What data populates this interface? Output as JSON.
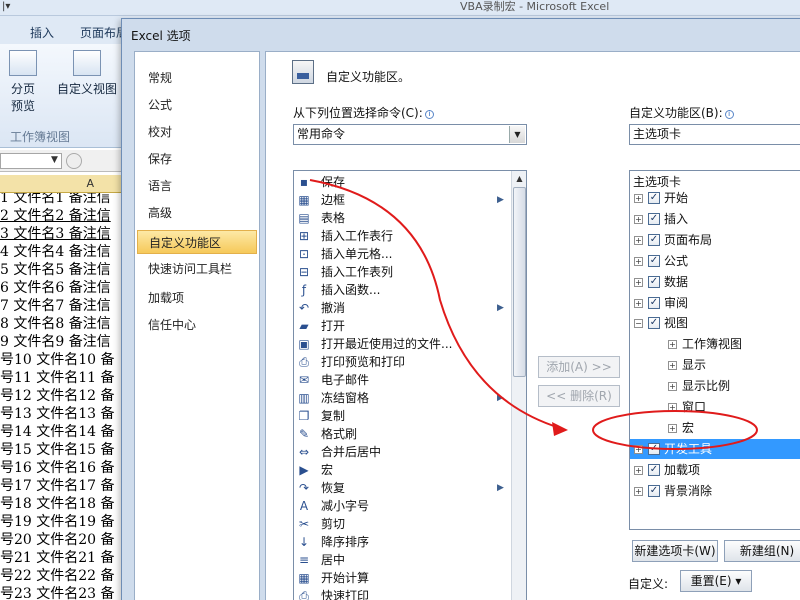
{
  "app": {
    "window_title": "VBA录制宏 - Microsoft Excel",
    "ribbon_tabs": [
      "插入",
      "页面布局"
    ],
    "ribbon_buttons": [
      {
        "name": "page-preview",
        "label_line1": "分页",
        "label_line2": "预览"
      },
      {
        "name": "custom-view",
        "label": "自定义视图"
      }
    ],
    "group_label": "工作簿视图",
    "column_header": "A",
    "rows": [
      "1  文件名1  备注信",
      "2  文件名2  备注信",
      "3  文件名3  备注信",
      "4  文件名4  备注信",
      "5  文件名5  备注信",
      "6  文件名6  备注信",
      "7  文件名7  备注信",
      "8  文件名8  备注信",
      "9  文件名9  备注信",
      "号10  文件名10  备",
      "号11  文件名11  备",
      "号12  文件名12  备",
      "号13  文件名13  备",
      "号14  文件名14  备",
      "号15  文件名15  备",
      "号16  文件名16  备",
      "号17  文件名17  备",
      "号18  文件名18  备",
      "号19  文件名19  备",
      "号20  文件名20  备",
      "号21  文件名21  备",
      "号22  文件名22  备",
      "号23  文件名23  备"
    ]
  },
  "dialog": {
    "title": "Excel 选项",
    "nav": [
      "常规",
      "公式",
      "校对",
      "保存",
      "语言",
      "高级",
      "自定义功能区",
      "快速访问工具栏",
      "加载项",
      "信任中心"
    ],
    "nav_selected": "自定义功能区",
    "header": "自定义功能区。",
    "choose_from_label": "从下列位置选择命令(C):",
    "choose_from_value": "常用命令",
    "customize_label": "自定义功能区(B):",
    "customize_value": "主选项卡",
    "commands": [
      {
        "icon": "save-icon",
        "glyph": "▪",
        "label": "保存",
        "submenu": false
      },
      {
        "icon": "border-icon",
        "glyph": "▦",
        "label": "边框",
        "submenu": true
      },
      {
        "icon": "table-icon",
        "glyph": "▤",
        "label": "表格",
        "submenu": false
      },
      {
        "icon": "insert-sheet-row-icon",
        "glyph": "⊞",
        "label": "插入工作表行",
        "submenu": false
      },
      {
        "icon": "insert-cell-icon",
        "glyph": "⊡",
        "label": "插入单元格...",
        "submenu": false
      },
      {
        "icon": "insert-sheet-column-icon",
        "glyph": "⊟",
        "label": "插入工作表列",
        "submenu": false
      },
      {
        "icon": "function-icon",
        "glyph": "ƒ",
        "label": "插入函数...",
        "submenu": false
      },
      {
        "icon": "undo-icon",
        "glyph": "↶",
        "label": "撤消",
        "submenu": true
      },
      {
        "icon": "open-icon",
        "glyph": "▰",
        "label": "打开",
        "submenu": false
      },
      {
        "icon": "recent-file-icon",
        "glyph": "▣",
        "label": "打开最近使用过的文件...",
        "submenu": false
      },
      {
        "icon": "print-preview-icon",
        "glyph": "⎙",
        "label": "打印预览和打印",
        "submenu": false
      },
      {
        "icon": "email-icon",
        "glyph": "✉",
        "label": "电子邮件",
        "submenu": false
      },
      {
        "icon": "freeze-panes-icon",
        "glyph": "▥",
        "label": "冻结窗格",
        "submenu": true
      },
      {
        "icon": "copy-icon",
        "glyph": "❐",
        "label": "复制",
        "submenu": false
      },
      {
        "icon": "format-painter-icon",
        "glyph": "✎",
        "label": "格式刷",
        "submenu": false
      },
      {
        "icon": "merge-center-icon",
        "glyph": "⇔",
        "label": "合并后居中",
        "submenu": false
      },
      {
        "icon": "macro-icon",
        "glyph": "▶",
        "label": "宏",
        "submenu": false
      },
      {
        "icon": "redo-icon",
        "glyph": "↷",
        "label": "恢复",
        "submenu": true
      },
      {
        "icon": "decrease-font-icon",
        "glyph": "A",
        "label": "减小字号",
        "submenu": false
      },
      {
        "icon": "cut-icon",
        "glyph": "✂",
        "label": "剪切",
        "submenu": false
      },
      {
        "icon": "sort-descending-icon",
        "glyph": "↓",
        "label": "降序排序",
        "submenu": false
      },
      {
        "icon": "center-icon",
        "glyph": "≡",
        "label": "居中",
        "submenu": false
      },
      {
        "icon": "calculate-icon",
        "glyph": "▦",
        "label": "开始计算",
        "submenu": false
      },
      {
        "icon": "quick-print-icon",
        "glyph": "⎙",
        "label": "快速打印",
        "submenu": false
      }
    ],
    "add_button": "添加(A) >>",
    "remove_button": "<< 删除(R)",
    "tree_header": "主选项卡",
    "tree": [
      {
        "label": "开始",
        "level": 0,
        "expander": "+",
        "checked": true
      },
      {
        "label": "插入",
        "level": 0,
        "expander": "+",
        "checked": true
      },
      {
        "label": "页面布局",
        "level": 0,
        "expander": "+",
        "checked": true
      },
      {
        "label": "公式",
        "level": 0,
        "expander": "+",
        "checked": true
      },
      {
        "label": "数据",
        "level": 0,
        "expander": "+",
        "checked": true
      },
      {
        "label": "审阅",
        "level": 0,
        "expander": "+",
        "checked": true
      },
      {
        "label": "视图",
        "level": 0,
        "expander": "−",
        "checked": true
      },
      {
        "label": "工作簿视图",
        "level": 1,
        "expander": "+",
        "checked": null
      },
      {
        "label": "显示",
        "level": 1,
        "expander": "+",
        "checked": null
      },
      {
        "label": "显示比例",
        "level": 1,
        "expander": "+",
        "checked": null
      },
      {
        "label": "窗口",
        "level": 1,
        "expander": "+",
        "checked": null
      },
      {
        "label": "宏",
        "level": 1,
        "expander": "+",
        "checked": null
      },
      {
        "label": "开发工具",
        "level": 0,
        "expander": "+",
        "checked": true,
        "highlighted": true
      },
      {
        "label": "加载项",
        "level": 0,
        "expander": "+",
        "checked": true
      },
      {
        "label": "背景消除",
        "level": 0,
        "expander": "+",
        "checked": true
      }
    ],
    "new_tab_button": "新建选项卡(W)",
    "new_group_button": "新建组(N)",
    "customize_footer_label": "自定义:",
    "reset_button": "重置(E) ▾"
  },
  "colors": {
    "annotation_red": "#e01b1b",
    "highlight_blue": "#3399ff",
    "nav_selected": "#f6c95a"
  }
}
